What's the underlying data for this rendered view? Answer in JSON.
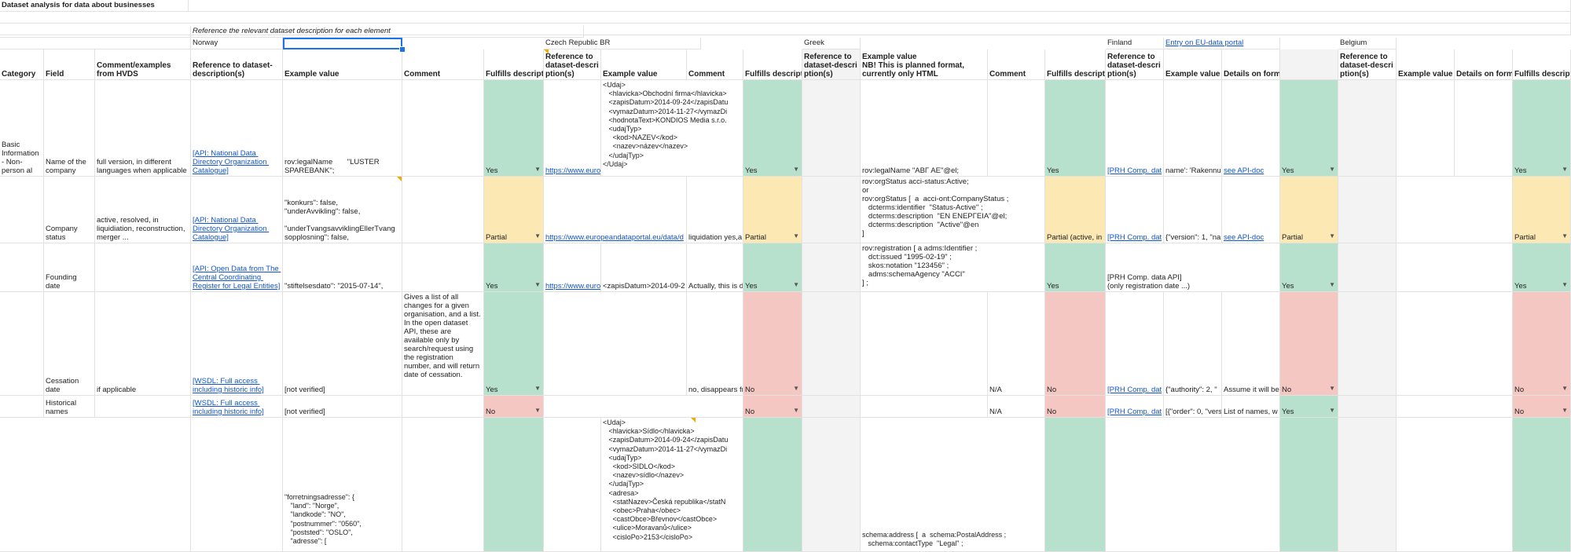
{
  "title": "Dataset analysis for data about businesses",
  "note": "Reference the relevant dataset description for each element",
  "countries": {
    "norway": "Norway",
    "czech": "Czech Republic BR",
    "greek": "Greek",
    "finland": "Finland",
    "finland_link": "Entry on EU-data portal",
    "belgium": "Belgium"
  },
  "headers": {
    "category": "Category",
    "field": "Field",
    "comment_hvds": "Comment/examples from HVDS",
    "ref_desc": "Reference to dataset-description(s)",
    "example": "Example value",
    "comment": "Comment",
    "fulfills": "Fulfills descript",
    "fulfills_full": "Fulfills descriptio",
    "ref_desc_short": "Reference to dataset-descri ption(s)",
    "ref_desc_cz": "Reference to dataset-descri ption(s)",
    "example_greek": "Example value\nNB! This is planned format, currently only HTML",
    "details": "Details on format, data model, c",
    "details_short": "Details on form"
  },
  "rows": {
    "name": {
      "category": "Basic Information - Non-person al",
      "field": "Name of the company",
      "hvds": "full version, in different languages when applicable",
      "no_ref": "[API: National Data Directory Organization Catalogue]",
      "no_example": "rov:legalName       \"LUSTER\nSPAREBANK\";",
      "no_fulfills": "Yes",
      "cz_ref": "https://www.euro",
      "cz_example": "<Udaj>\n   <hlavicka>Obchodní firma</hlavicka>\n   <zapisDatum>2014-09-24</zapisDatu\n   <vymazDatum>2014-11-27</vymazDi\n   <hodnotaText>KONDIOS Media s.r.o.\n   <udajTyp>\n     <kod>NAZEV</kod>\n     <nazev>název</nazev>\n   </udajTyp>\n</Udaj>",
      "cz_fulfills": "Yes",
      "gr_example": "rov:legalName \"ΑΒΓ ΑΕ\"@el;",
      "gr_fulfills": "Yes",
      "fi_ref": "[PRH Comp. dat",
      "fi_example": "name': 'Rakennu",
      "fi_details": "see API-doc",
      "fi_fulfills": "Yes",
      "be_fulfills": "Yes"
    },
    "status": {
      "field": "Company status",
      "hvds": "active, resolved, in liquidiation, reconstruction, merger ...",
      "no_ref": "[API: National Data Directory Organization Catalogue]",
      "no_example": "\"konkurs\": false,\n\"underAvvikling\": false,\n\n\"underTvangsavviklingEllerTvang\nsopplosning\": false,",
      "no_fulfills": "Partial",
      "cz_ref": "https://www.europeandataportal.eu/data/d",
      "cz_comment": "liquidation yes,a",
      "cz_fulfills": "Partial",
      "gr_example": "rov:orgStatus acci-status:Active;\nor\nrov:orgStatus [  a  acci-ont:CompanyStatus ;\n   dcterms:identifier  \"Status-Active\" ;\n   dcterms:description  \"ΕΝ ΕΝΕΡΓΕΙΑ\"@el;\n   dcterms:description  \"Active\"@en\n]",
      "gr_fulfills": "Partial (active, in",
      "fi_ref": "[PRH Comp. dat",
      "fi_example": "{\"version\": 1, \"na",
      "fi_details": "see API-doc",
      "fi_fulfills": "Partial",
      "be_fulfills": "Partial"
    },
    "founding": {
      "field": "Founding date",
      "no_ref": "[API: Open Data from The Central Coordinating Register for Legal Entities]",
      "no_example": "\"stiftelsesdato\": \"2015-07-14\",",
      "no_fulfills": "Yes",
      "cz_ref": "https://www.euro",
      "cz_example": "<zapisDatum>2014-09-2",
      "cz_comment": "Actually, this is d",
      "cz_fulfills": "Yes",
      "gr_example": "rov:registration [ a adms:Identifier ;\n   dct:issued \"1995-02-19\" ;\n   skos:notation \"123456\" ;\n   adms:schemaAgency \"ACCI\"\n] ;",
      "gr_fulfills": "Yes",
      "fi_ref": "[PRH Comp. data API]\n(only registration date ...)",
      "fi_fulfills": "Yes",
      "be_fulfills": "Yes"
    },
    "cessation": {
      "field": "Cessation date",
      "hvds": "if applicable",
      "no_ref": "[WSDL: Full access including historic info]",
      "no_example": "[not verified]",
      "no_comment": "Gives a list of all changes for a given organisation, and a list.\nIn the open dataset API, these are available only by search/request using the registration number, and will return date of cessation.",
      "no_fulfills": "Yes",
      "cz_comment": "no, disappears fr",
      "cz_fulfills": "No",
      "gr_comment": "N/A",
      "gr_fulfills": "No",
      "fi_ref": "[PRH Comp. dat",
      "fi_example": "{\"authority\": 2, \"",
      "fi_details": "Assume it will be",
      "fi_fulfills": "No",
      "be_fulfills": "No"
    },
    "historical": {
      "field": "Historical names",
      "no_ref": "[WSDL: Full access including historic info]",
      "no_example": "[not verified]",
      "no_fulfills": "No",
      "cz_fulfills": "No",
      "gr_comment": "N/A",
      "gr_fulfills": "No",
      "fi_ref": "[PRH Comp. dat",
      "fi_example": "[{\"order\": 0, \"vers",
      "fi_details": "List of names, w",
      "fi_fulfills": "Yes",
      "be_fulfills": "No"
    },
    "address": {
      "no_example": "\"forretningsadresse\": {\n   \"land\": \"Norge\",\n   \"landkode\": \"NO\",\n   \"postnummer\": \"0560\",\n   \"poststed\": \"OSLO\",\n   \"adresse\": [",
      "cz_example": "<Udaj>\n   <hlavicka>Sídlo</hlavicka>\n   <zapisDatum>2014-09-24</zapisDatu\n   <vymazDatum>2014-11-27</vymazDi\n   <udajTyp>\n     <kod>SIDLO</kod>\n     <nazev>sídlo</nazev>\n   </udajTyp>\n   <adresa>\n     <statNazev>Česká republika</statN\n     <obec>Praha</obec>\n     <castObce>Břevnov</castObce>\n     <ulice>Moravanů</ulice>\n     <cisloPo>2153</cisloPo>",
      "gr_example": "schema:address [  a  schema:PostalAddress ;\n   schema:contactType  \"Legal\" ;"
    }
  },
  "colors": {
    "green": "#b7e1cd",
    "yellow": "#fce8b2",
    "red": "#f4c7c3",
    "link": "#1155cc",
    "selection": "#1a73e8"
  }
}
